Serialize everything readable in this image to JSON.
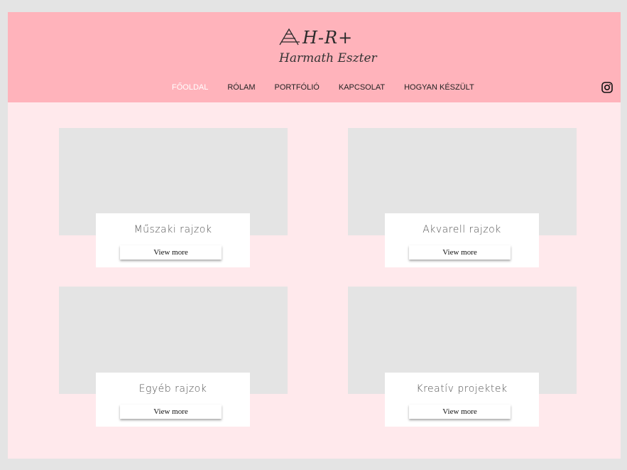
{
  "logo": {
    "mark_text": "H-R+",
    "name": "Harmath Eszter"
  },
  "nav": {
    "items": [
      {
        "label": "FŐOLDAL",
        "active": true
      },
      {
        "label": "RÓLAM",
        "active": false
      },
      {
        "label": "PORTFÓLIÓ",
        "active": false
      },
      {
        "label": "KAPCSOLAT",
        "active": false
      },
      {
        "label": "HOGYAN KÉSZÜLT",
        "active": false
      }
    ],
    "social_icon": "instagram-icon"
  },
  "cards": [
    {
      "title": "Műszaki rajzok",
      "button": "View more"
    },
    {
      "title": "Akvarell rajzok",
      "button": "View more"
    },
    {
      "title": "Egyéb rajzok",
      "button": "View more"
    },
    {
      "title": "Kreatív projektek",
      "button": "View more"
    }
  ],
  "colors": {
    "header_bg": "#ffb3bb",
    "page_bg": "#ffe9ec",
    "placeholder": "#e4e4e4",
    "active_nav": "#ffffff"
  }
}
